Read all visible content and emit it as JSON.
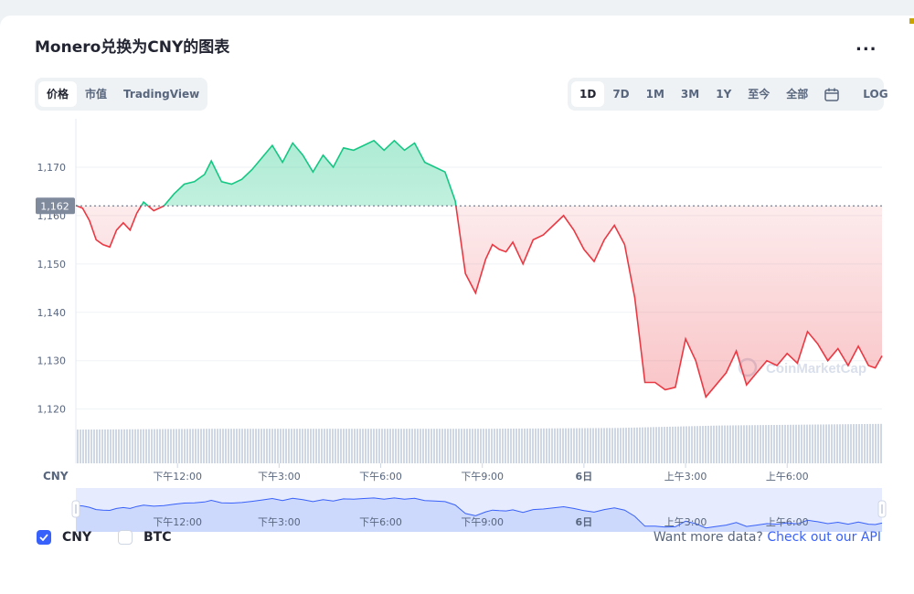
{
  "title": "Monero兑换为CNY的图表",
  "more_label": "...",
  "view_tabs": [
    {
      "label": "价格",
      "active": true
    },
    {
      "label": "市值",
      "active": false
    },
    {
      "label": "TradingView",
      "active": false
    }
  ],
  "range_tabs": [
    {
      "label": "1D",
      "active": true
    },
    {
      "label": "7D",
      "active": false
    },
    {
      "label": "1M",
      "active": false
    },
    {
      "label": "3M",
      "active": false
    },
    {
      "label": "1Y",
      "active": false
    },
    {
      "label": "至今",
      "active": false
    },
    {
      "label": "全部",
      "active": false
    }
  ],
  "log_label": "LOG",
  "calendar_icon": "calendar-icon",
  "legend": [
    {
      "label": "CNY",
      "checked": true
    },
    {
      "label": "BTC",
      "checked": false
    }
  ],
  "api_text": "Want more data?",
  "api_link": "Check out our API",
  "watermark": "CoinMarketCap",
  "colors": {
    "up": "#16c784",
    "down": "#ea3943",
    "accent": "#3861fb",
    "volume": "#cfd6e4"
  },
  "chart_data": {
    "type": "area",
    "currency_label": "CNY",
    "reference_value": 1162,
    "reference_label": "1,162",
    "ylim": [
      1112,
      1180
    ],
    "y_ticks": [
      {
        "value": 1120,
        "label": "1,120"
      },
      {
        "value": 1130,
        "label": "1,130"
      },
      {
        "value": 1140,
        "label": "1,140"
      },
      {
        "value": 1150,
        "label": "1,150"
      },
      {
        "value": 1160,
        "label": "1,160"
      },
      {
        "value": 1170,
        "label": "1,170"
      }
    ],
    "x_ticks": [
      "下午12:00",
      "下午3:00",
      "下午6:00",
      "下午9:00",
      "6日",
      "上午3:00",
      "上午6:00"
    ],
    "x_tick_hours": [
      3,
      6,
      9,
      12,
      15,
      18,
      21
    ],
    "x_range_hours": [
      0,
      23.8
    ],
    "series": [
      {
        "hours": [
          0,
          0.2,
          0.4,
          0.6,
          0.8,
          1.0,
          1.2,
          1.4,
          1.6,
          1.8,
          2.0,
          2.3,
          2.6,
          2.9,
          3.2,
          3.5,
          3.8,
          4.0,
          4.3,
          4.6,
          4.9,
          5.2,
          5.5,
          5.8,
          6.1,
          6.4,
          6.7,
          7.0,
          7.3,
          7.6,
          7.9,
          8.2,
          8.5,
          8.8,
          9.1,
          9.4,
          9.7,
          10.0,
          10.3,
          10.6,
          10.9,
          11.2,
          11.5,
          11.8,
          12.1,
          12.3,
          12.5,
          12.7,
          12.9,
          13.2,
          13.5,
          13.8,
          14.1,
          14.4,
          14.7,
          15.0,
          15.3,
          15.6,
          15.9,
          16.2,
          16.5,
          16.8,
          17.1,
          17.4,
          17.7,
          18.0,
          18.3,
          18.6,
          18.9,
          19.2,
          19.5,
          19.8,
          20.1,
          20.4,
          20.7,
          21.0,
          21.3,
          21.6,
          21.9,
          22.2,
          22.5,
          22.8,
          23.1,
          23.4,
          23.6,
          23.8
        ],
        "values": [
          1162.1,
          1161.5,
          1159.0,
          1155.0,
          1154.0,
          1153.5,
          1157.0,
          1158.5,
          1157.0,
          1160.5,
          1162.8,
          1161.0,
          1162.0,
          1164.5,
          1166.5,
          1167.0,
          1168.5,
          1171.3,
          1167.0,
          1166.5,
          1167.5,
          1169.5,
          1172.0,
          1174.5,
          1171.0,
          1175.0,
          1172.5,
          1169.0,
          1172.5,
          1170.0,
          1174.0,
          1173.5,
          1174.5,
          1175.5,
          1173.5,
          1175.5,
          1173.5,
          1175.0,
          1171.0,
          1170.0,
          1169.0,
          1163.0,
          1148.0,
          1144.0,
          1151.0,
          1154.0,
          1153.0,
          1152.5,
          1154.5,
          1150.0,
          1155.0,
          1156.0,
          1158.0,
          1160.0,
          1157.0,
          1153.0,
          1150.5,
          1155.0,
          1158.0,
          1154.0,
          1143.0,
          1125.5,
          1125.5,
          1124.0,
          1124.5,
          1134.5,
          1130.0,
          1122.5,
          1125.0,
          1127.5,
          1132.0,
          1125.0,
          1127.5,
          1130.0,
          1129.0,
          1131.5,
          1129.5,
          1136.0,
          1133.5,
          1130.0,
          1132.5,
          1129.0,
          1133.0,
          1129.0,
          1128.5,
          1131.0
        ]
      }
    ],
    "volume": [
      {
        "hour": 0,
        "value": 0.82
      },
      {
        "hour": 4,
        "value": 0.84
      },
      {
        "hour": 8,
        "value": 0.84
      },
      {
        "hour": 12,
        "value": 0.84
      },
      {
        "hour": 16,
        "value": 0.86
      },
      {
        "hour": 19,
        "value": 0.92
      },
      {
        "hour": 23.8,
        "value": 0.96
      }
    ]
  }
}
